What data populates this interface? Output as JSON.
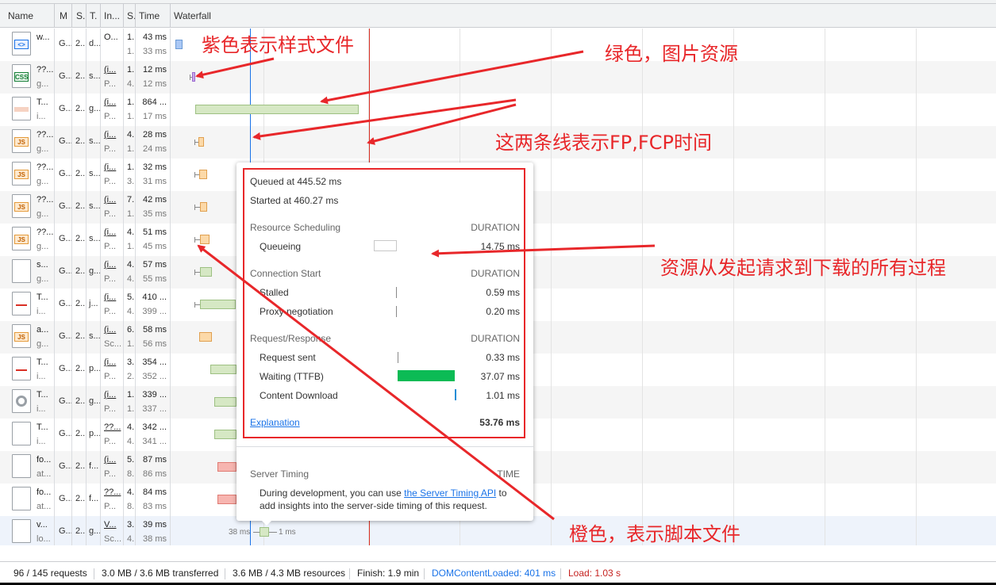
{
  "columns": [
    "Name",
    "M",
    "S.",
    "T.",
    "In...",
    "S.",
    "Time",
    "Waterfall"
  ],
  "rows": [
    {
      "icon": "doc",
      "name1": "w...",
      "name2": "",
      "method": "G...",
      "status": "2...",
      "type": "d...",
      "init1": "O...",
      "init2": "",
      "size1": "1.",
      "size2": "1.",
      "time1": "43 ms",
      "time2": "33 ms"
    },
    {
      "icon": "css",
      "name1": "??...",
      "name2": "g...",
      "method": "G...",
      "status": "2...",
      "type": "s...",
      "init1": "(i...",
      "init2": "P...",
      "size1": "1.",
      "size2": "4.",
      "time1": "12 ms",
      "time2": "12 ms"
    },
    {
      "icon": "img",
      "name1": "T...",
      "name2": "i...",
      "method": "G...",
      "status": "2...",
      "type": "g...",
      "init1": "(i...",
      "init2": "P...",
      "size1": "1.",
      "size2": "1.",
      "time1": "864 ...",
      "time2": "17 ms"
    },
    {
      "icon": "js",
      "name1": "??...",
      "name2": "g...",
      "method": "G...",
      "status": "2...",
      "type": "s...",
      "init1": "(i...",
      "init2": "P...",
      "size1": "4.",
      "size2": "1.",
      "time1": "28 ms",
      "time2": "24 ms"
    },
    {
      "icon": "js",
      "name1": "??...",
      "name2": "g...",
      "method": "G...",
      "status": "2...",
      "type": "s...",
      "init1": "(i...",
      "init2": "P...",
      "size1": "1.",
      "size2": "3.",
      "time1": "32 ms",
      "time2": "31 ms"
    },
    {
      "icon": "js",
      "name1": "??...",
      "name2": "g...",
      "method": "G...",
      "status": "2...",
      "type": "s...",
      "init1": "(i...",
      "init2": "P...",
      "size1": "7.",
      "size2": "1.",
      "time1": "42 ms",
      "time2": "35 ms"
    },
    {
      "icon": "js",
      "name1": "??...",
      "name2": "g...",
      "method": "G...",
      "status": "2...",
      "type": "s...",
      "init1": "(i...",
      "init2": "P...",
      "size1": "4.",
      "size2": "1.",
      "time1": "51 ms",
      "time2": "45 ms"
    },
    {
      "icon": "blank",
      "name1": "s...",
      "name2": "g...",
      "method": "G...",
      "status": "2...",
      "type": "g...",
      "init1": "(i...",
      "init2": "P...",
      "size1": "4.",
      "size2": "4.",
      "time1": "57 ms",
      "time2": "55 ms"
    },
    {
      "icon": "img2",
      "name1": "T...",
      "name2": "i...",
      "method": "G...",
      "status": "2...",
      "type": "j...",
      "init1": "(i...",
      "init2": "P...",
      "size1": "5.",
      "size2": "4.",
      "time1": "410 ...",
      "time2": "399 ..."
    },
    {
      "icon": "js",
      "name1": "a...",
      "name2": "g...",
      "method": "G...",
      "status": "2...",
      "type": "s...",
      "init1": "(i...",
      "init2": "Sc...",
      "size1": "6.",
      "size2": "1.",
      "time1": "58 ms",
      "time2": "56 ms"
    },
    {
      "icon": "img2",
      "name1": "T...",
      "name2": "i...",
      "method": "G...",
      "status": "2...",
      "type": "p...",
      "init1": "(i...",
      "init2": "P...",
      "size1": "3.",
      "size2": "2.",
      "time1": "354 ...",
      "time2": "352 ..."
    },
    {
      "icon": "gear",
      "name1": "T...",
      "name2": "i...",
      "method": "G...",
      "status": "2...",
      "type": "g...",
      "init1": "(i...",
      "init2": "P...",
      "size1": "1.",
      "size2": "1.",
      "time1": "339 ...",
      "time2": "337 ..."
    },
    {
      "icon": "blank",
      "name1": "T...",
      "name2": "i...",
      "method": "G...",
      "status": "2...",
      "type": "p...",
      "init1": "??...",
      "init2": "P...",
      "size1": "4.",
      "size2": "4.",
      "time1": "342 ...",
      "time2": "341 ..."
    },
    {
      "icon": "blank",
      "name1": "fo...",
      "name2": "at...",
      "method": "G...",
      "status": "2...",
      "type": "f...",
      "init1": "(i...",
      "init2": "P...",
      "size1": "5.",
      "size2": "8.",
      "time1": "87 ms",
      "time2": "86 ms"
    },
    {
      "icon": "blank",
      "name1": "fo...",
      "name2": "at...",
      "method": "G...",
      "status": "2...",
      "type": "f...",
      "init1": "??...",
      "init2": "P...",
      "size1": "4.",
      "size2": "8.",
      "time1": "84 ms",
      "time2": "83 ms"
    },
    {
      "icon": "blank",
      "name1": "v...",
      "name2": "lo...",
      "method": "G...",
      "status": "2...",
      "type": "g...",
      "init1": "V...",
      "init2": "Sc...",
      "size1": "3.",
      "size2": "4.",
      "time1": "39 ms",
      "time2": "38 ms"
    }
  ],
  "waterfall": {
    "tail_left_label": "38 ms",
    "tail_right_label": "1 ms"
  },
  "status_bar": {
    "requests": "96 / 145 requests",
    "transferred": "3.0 MB / 3.6 MB transferred",
    "resources": "3.6 MB / 4.3 MB resources",
    "finish": "Finish: 1.9 min",
    "dom_content_loaded": "DOMContentLoaded: 401 ms",
    "load": "Load: 1.03 s"
  },
  "timing_popup": {
    "queued_at": "Queued at 445.52 ms",
    "started_at": "Started at 460.27 ms",
    "sec_scheduling": "Resource Scheduling",
    "sec_connection": "Connection Start",
    "sec_request": "Request/Response",
    "duration_label": "DURATION",
    "queueing_label": "Queueing",
    "queueing_value": "14.75 ms",
    "stalled_label": "Stalled",
    "stalled_value": "0.59 ms",
    "proxy_label": "Proxy negotiation",
    "proxy_value": "0.20 ms",
    "request_sent_label": "Request sent",
    "request_sent_value": "0.33 ms",
    "waiting_label": "Waiting (TTFB)",
    "waiting_value": "37.07 ms",
    "download_label": "Content Download",
    "download_value": "1.01 ms",
    "explanation_link": "Explanation",
    "total_value": "53.76 ms",
    "server_timing_label": "Server Timing",
    "time_label": "TIME",
    "server_text_prefix": "During development, you can use ",
    "server_link": "the Server Timing API",
    "server_text_suffix": " to",
    "server_text_line2": "add insights into the server-side timing of this request."
  },
  "annotations": {
    "purple": "紫色表示样式文件",
    "green": "绿色，图片资源",
    "fp_lines": "这两条线表示FP,FCP时间",
    "process": "资源从发起请求到下载的所有过程",
    "orange": "橙色，表示脚本文件"
  },
  "colors": {
    "annotation_red": "#e8272a",
    "fp_line": "#1a73e8",
    "fcp_line": "#d93025",
    "waiting_bar": "#0cbb55",
    "download_bar": "#1f8dd6"
  }
}
